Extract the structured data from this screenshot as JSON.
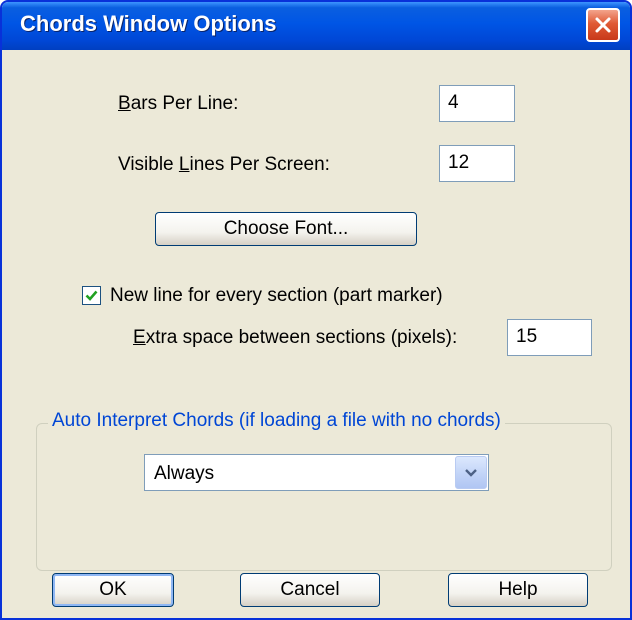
{
  "window": {
    "title": "Chords Window Options"
  },
  "fields": {
    "bars_per_line": {
      "label_mnemonic": "B",
      "label_rest": "ars Per Line:",
      "value": "4"
    },
    "visible_lines": {
      "label_pre": "Visible ",
      "label_mnemonic": "L",
      "label_rest": "ines Per Screen:",
      "value": "12"
    },
    "extra_space": {
      "label_pre": "",
      "label_mnemonic": "E",
      "label_rest": "xtra space between sections (pixels):",
      "value": "15"
    }
  },
  "choose_font_label": "Choose Font...",
  "new_line_checkbox": {
    "checked": true,
    "label": "New line for every section (part marker)"
  },
  "auto_interpret": {
    "legend": "Auto Interpret Chords (if loading a file with no chords)",
    "selected": "Always"
  },
  "buttons": {
    "ok": "OK",
    "cancel": "Cancel",
    "help": "Help"
  },
  "colors": {
    "title_bar": "#0055e5",
    "legend_text": "#0046d5",
    "dialog_face": "#ece9d8"
  }
}
